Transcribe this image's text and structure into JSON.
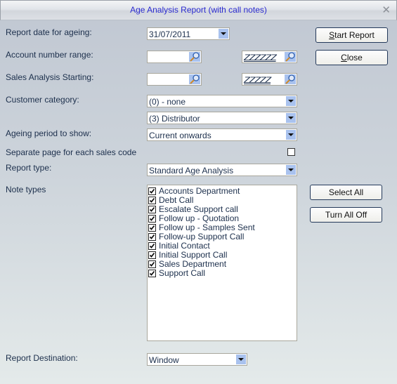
{
  "window": {
    "title": "Age Analysis Report (with call notes)",
    "close_glyph": "✕"
  },
  "form": {
    "report_date": {
      "label": "Report date for ageing:",
      "value": "31/07/2011"
    },
    "account_range": {
      "label": "Account number range:",
      "from": "",
      "to": "ZZZZZZ"
    },
    "sales_analysis": {
      "label": "Sales Analysis Starting:",
      "from": "",
      "to": "ZZZZZ"
    },
    "customer_category": {
      "label": "Customer category:",
      "from": "(0) - none",
      "to": "(3) Distributor"
    },
    "ageing_period": {
      "label": "Ageing period to show:",
      "value": "Current onwards"
    },
    "separate_page": {
      "label": "Separate page for each sales code",
      "checked": false
    },
    "report_type": {
      "label": "Report type:",
      "value": "Standard Age Analysis"
    },
    "note_types": {
      "label": "Note types",
      "items": [
        {
          "label": "Accounts Department",
          "checked": true
        },
        {
          "label": "Debt Call",
          "checked": true
        },
        {
          "label": "Escalate Support call",
          "checked": true
        },
        {
          "label": "Follow up - Quotation",
          "checked": true
        },
        {
          "label": "Follow up - Samples Sent",
          "checked": true
        },
        {
          "label": "Follow-up Support Call",
          "checked": true
        },
        {
          "label": "Initial Contact",
          "checked": true
        },
        {
          "label": "Initial Support Call",
          "checked": true
        },
        {
          "label": "Sales Department",
          "checked": true
        },
        {
          "label": "Support Call",
          "checked": true
        }
      ]
    },
    "report_destination": {
      "label": "Report Destination:",
      "value": "Window"
    }
  },
  "buttons": {
    "start_report": {
      "accel": "S",
      "rest": "tart Report"
    },
    "close": {
      "accel": "C",
      "rest": "lose"
    },
    "select_all": "Select All",
    "turn_all_off": "Turn All Off"
  },
  "colors": {
    "title_text": "#2a2ad0",
    "dropdown_button": "#a9c2ee",
    "label_text": "#1c2f4c"
  }
}
